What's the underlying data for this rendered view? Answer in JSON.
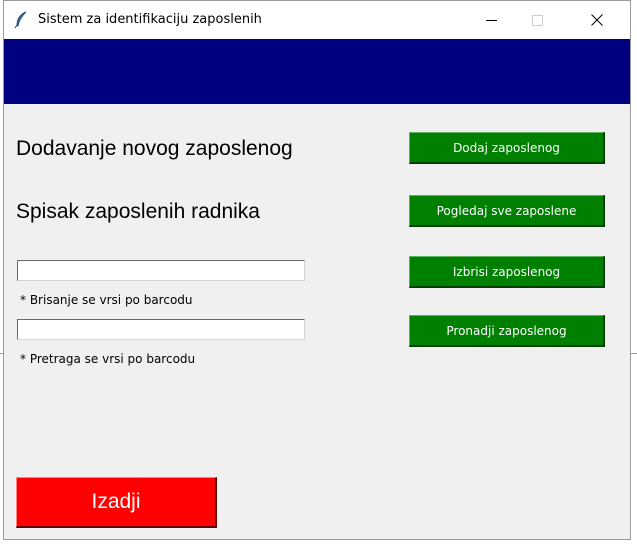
{
  "window": {
    "title": "Sistem za identifikaciju zaposlenih",
    "minimize_icon": "minimize-icon",
    "maximize_icon": "maximize-icon",
    "close_icon": "close-icon",
    "app_icon": "feather-icon"
  },
  "colors": {
    "header_band": "#000080",
    "green_button": "#008000",
    "exit_button": "#ff0000",
    "window_bg": "#f0f0f0"
  },
  "main": {
    "heading_add": "Dodavanje novog zaposlenog",
    "heading_list": "Spisak zaposlenih radnika",
    "delete_field": {
      "value": "",
      "placeholder": ""
    },
    "delete_hint": "* Brisanje se vrsi po barcodu",
    "search_field": {
      "value": "",
      "placeholder": ""
    },
    "search_hint": "* Pretraga se vrsi po barcodu"
  },
  "buttons": {
    "add": "Dodaj zaposlenog",
    "view_all": "Pogledaj sve zaposlene",
    "delete": "Izbrisi zaposlenog",
    "find": "Pronadji zaposlenog",
    "exit": "Izadji"
  }
}
